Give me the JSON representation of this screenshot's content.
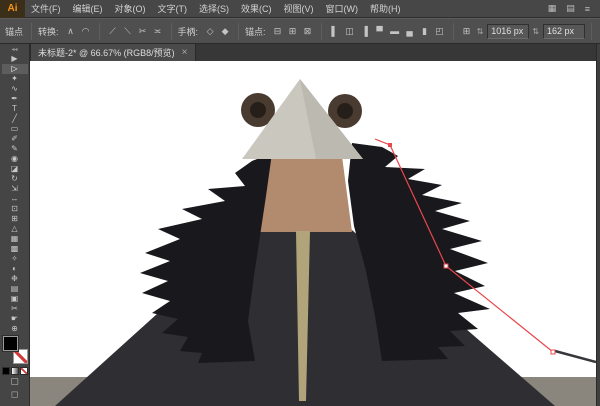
{
  "app": {
    "logo_text": "Ai",
    "menus": [
      {
        "name": "menu-file",
        "label": "文件(F)"
      },
      {
        "name": "menu-edit",
        "label": "编辑(E)"
      },
      {
        "name": "menu-object",
        "label": "对象(O)"
      },
      {
        "name": "menu-type",
        "label": "文字(T)"
      },
      {
        "name": "menu-select",
        "label": "选择(S)"
      },
      {
        "name": "menu-effect",
        "label": "效果(C)"
      },
      {
        "name": "menu-view",
        "label": "视图(V)"
      },
      {
        "name": "menu-window",
        "label": "窗口(W)"
      },
      {
        "name": "menu-help",
        "label": "帮助(H)"
      }
    ],
    "menubar_icons": [
      {
        "name": "arrange-documents-icon",
        "glyph": "▦"
      },
      {
        "name": "workspace-switcher-icon",
        "glyph": "▤"
      },
      {
        "name": "app-bar-menu-icon",
        "glyph": "≡"
      }
    ]
  },
  "controlbar": {
    "context_label": "锚点",
    "convert_label": "转换:",
    "convert_icons": [
      {
        "name": "convert-to-corner-icon",
        "glyph": "∧"
      },
      {
        "name": "convert-to-smooth-icon",
        "glyph": "◠"
      }
    ],
    "anchor_op_icons": [
      {
        "name": "remove-anchor-icon",
        "glyph": "⟋"
      },
      {
        "name": "add-anchor-icon",
        "glyph": "⟍"
      },
      {
        "name": "cut-path-icon",
        "glyph": "✂"
      },
      {
        "name": "connect-path-icon",
        "glyph": "≍"
      }
    ],
    "handles_label": "手柄:",
    "handle_icons": [
      {
        "name": "show-handles-icon",
        "glyph": "◇"
      },
      {
        "name": "hide-handles-icon",
        "glyph": "◆"
      }
    ],
    "anchors_label": "锚点:",
    "anchor_icons": [
      {
        "name": "delete-anchor-icon",
        "glyph": "⊟"
      },
      {
        "name": "join-path-icon",
        "glyph": "⊞"
      },
      {
        "name": "isolate-selection-icon",
        "glyph": "⊠"
      }
    ],
    "align_icons": [
      {
        "name": "align-left-icon",
        "glyph": "▌"
      },
      {
        "name": "align-center-icon",
        "glyph": "◫"
      },
      {
        "name": "align-right-icon",
        "glyph": "▐"
      },
      {
        "name": "align-top-icon",
        "glyph": "▀"
      },
      {
        "name": "align-middle-icon",
        "glyph": "▬"
      },
      {
        "name": "align-bottom-icon",
        "glyph": "▄"
      },
      {
        "name": "distribute-h-icon",
        "glyph": "▮"
      },
      {
        "name": "distribute-v-icon",
        "glyph": "◰"
      }
    ],
    "reference_point_icon": {
      "glyph": "⊞"
    },
    "x_field": {
      "stepper": "⇅",
      "value": "1016 px"
    },
    "y_field": {
      "stepper": "⇅",
      "value": "162 px"
    },
    "right_icons": [
      {
        "name": "transform-panel-icon",
        "glyph": "≣"
      },
      {
        "name": "stroke-options-icon",
        "glyph": "▾"
      },
      {
        "name": "panel-menu-icon",
        "glyph": "≡"
      }
    ]
  },
  "tabbar": {
    "tab_title": "未标题-2* @ 66.67% (RGB8/预览)",
    "close_label": "×"
  },
  "toolbar": {
    "collapse_glyph": "◂◂",
    "tools": [
      {
        "name": "selection-tool",
        "glyph": "▶"
      },
      {
        "name": "direct-selection-tool",
        "glyph": "▷",
        "active": true
      },
      {
        "name": "magic-wand-tool",
        "glyph": "✦"
      },
      {
        "name": "lasso-tool",
        "glyph": "∿"
      },
      {
        "name": "pen-tool",
        "glyph": "✒"
      },
      {
        "name": "type-tool",
        "glyph": "T"
      },
      {
        "name": "line-tool",
        "glyph": "╱"
      },
      {
        "name": "rectangle-tool",
        "glyph": "▭"
      },
      {
        "name": "paintbrush-tool",
        "glyph": "✐"
      },
      {
        "name": "pencil-tool",
        "glyph": "✎"
      },
      {
        "name": "blob-brush-tool",
        "glyph": "◉"
      },
      {
        "name": "eraser-tool",
        "glyph": "◪"
      },
      {
        "name": "rotate-tool",
        "glyph": "↻"
      },
      {
        "name": "scale-tool",
        "glyph": "⇲"
      },
      {
        "name": "width-tool",
        "glyph": "↔"
      },
      {
        "name": "free-transform-tool",
        "glyph": "⊡"
      },
      {
        "name": "shape-builder-tool",
        "glyph": "⊞"
      },
      {
        "name": "perspective-grid-tool",
        "glyph": "△"
      },
      {
        "name": "mesh-tool",
        "glyph": "▦"
      },
      {
        "name": "gradient-tool",
        "glyph": "▩"
      },
      {
        "name": "eyedropper-tool",
        "glyph": "✧"
      },
      {
        "name": "blend-tool",
        "glyph": "◐"
      },
      {
        "name": "symbol-sprayer-tool",
        "glyph": "❉"
      },
      {
        "name": "graph-tool",
        "glyph": "▤"
      },
      {
        "name": "artboard-tool",
        "glyph": "▣"
      },
      {
        "name": "slice-tool",
        "glyph": "✂"
      },
      {
        "name": "hand-tool",
        "glyph": "☛"
      },
      {
        "name": "zoom-tool",
        "glyph": "⊕"
      }
    ]
  },
  "artwork": {
    "colors": {
      "artboard": "#ffffff",
      "ground": "#8a857d",
      "coat": "#2f2e33",
      "fur": "#19181c",
      "neck": "#b28a6d",
      "stripe": "#b2a47a",
      "hood": "#cac7bf",
      "hood_shade": "#bcb9b0",
      "ear_outer": "#493b30",
      "ear_inner": "#261f19",
      "path": "#e8474d",
      "ground_line": "#37363a"
    }
  }
}
